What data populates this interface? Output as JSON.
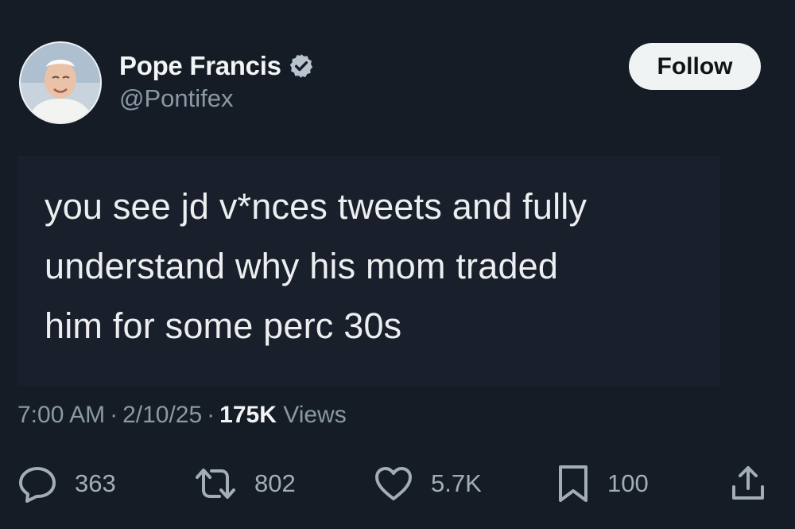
{
  "user": {
    "display_name": "Pope Francis",
    "handle": "@Pontifex",
    "verified_icon": "verified-badge-icon",
    "avatar": "avatar-photo"
  },
  "follow_button": {
    "label": "Follow"
  },
  "tweet": {
    "lines": [
      "you see jd v*nces tweets and fully",
      "understand why his mom traded",
      "him for some perc 30s"
    ]
  },
  "meta": {
    "time": "7:00 AM",
    "separator": "·",
    "date": "2/10/25",
    "views_count": "175K",
    "views_label": "Views"
  },
  "actions": {
    "reply": {
      "icon": "reply-bubble-icon",
      "count": "363"
    },
    "retweet": {
      "icon": "retweet-icon",
      "count": "802"
    },
    "like": {
      "icon": "heart-icon",
      "count": "5.7K"
    },
    "bookmark": {
      "icon": "bookmark-icon",
      "count": "100"
    },
    "share": {
      "icon": "share-icon"
    }
  },
  "colors": {
    "background": "#151c26",
    "text_primary": "#e7e9ea",
    "text_secondary": "#8b98a5",
    "follow_bg": "#eff3f4",
    "verified_badge": "#b8c3cf"
  }
}
